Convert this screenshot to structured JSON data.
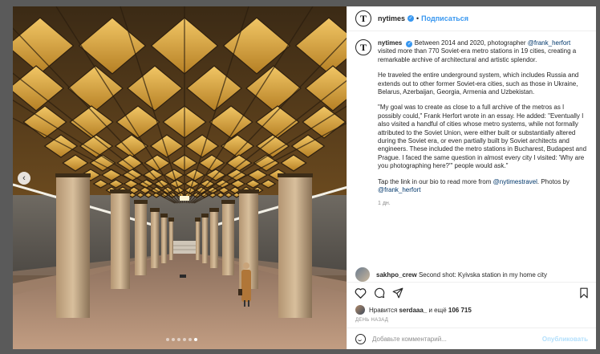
{
  "header": {
    "username": "nytimes",
    "separator": "•",
    "follow_label": "Подписаться",
    "avatar_letter": "T",
    "more_label": "•••"
  },
  "caption": {
    "username": "nytimes",
    "p1_after_name": "Between 2014 and 2020, photographer",
    "p1_mention": "@frank_herfort",
    "p1_rest": "visited more than 770 Soviet-era metro stations in 19 cities, creating a remarkable archive of architectural and artistic splendor.",
    "p2": "He traveled the entire underground system, which includes Russia and extends out to other former Soviet-era cities, such as those in Ukraine, Belarus, Azerbaijan, Georgia, Armenia and Uzbekistan.",
    "p3": "\"My goal was to create as close to a full archive of the metros as I possibly could,\" Frank Herfort wrote in an essay. He added: \"Eventually I also visited a handful of cities whose metro systems, while not formally attributed to the Soviet Union, were either built or substantially altered during the Soviet era, or even partially built by Soviet architects and engineers. These included the metro stations in Bucharest, Budapest and Prague. I faced the same question in almost every city I visited: 'Why are you photographing here?'\" people would ask.\"",
    "p4_before": "Tap the link in our bio to read more from",
    "p4_mention1": "@nytimestravel",
    "p4_mid": ". Photos by",
    "p4_mention2": "@frank_herfort",
    "time": "1 дн."
  },
  "comment": {
    "username": "sakhpo_crew",
    "text": "Second shot: Kyivska station in my home city"
  },
  "likes": {
    "prefix": "Нравится",
    "user": "serdaaa_",
    "mid": "и ещё",
    "count": "106 715"
  },
  "time_ago": "ДЕНЬ НАЗАД",
  "add_comment": {
    "placeholder": "Добавьте комментарий...",
    "publish_label": "Опубликовать"
  },
  "carousel": {
    "prev_label": "‹",
    "dot_count": 6,
    "active_index": 5
  },
  "colors": {
    "accent": "#3897f0",
    "link": "#00376b",
    "ceiling_light": "#d4a03c",
    "ceiling_dark": "#3a2a17",
    "floor": "#b9937a"
  },
  "icons": {
    "heart": "heart-icon",
    "comment": "comment-icon",
    "share": "share-icon",
    "bookmark": "bookmark-icon",
    "emoji": "emoji-icon"
  }
}
